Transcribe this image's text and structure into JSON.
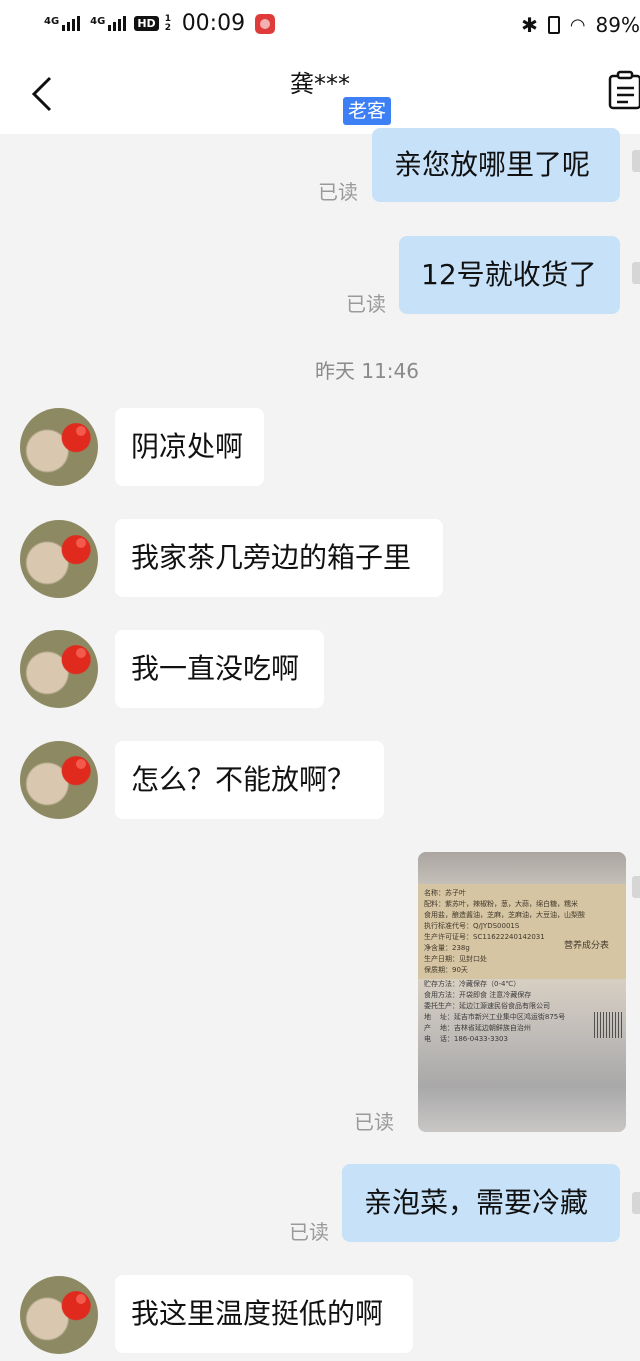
{
  "status_bar": {
    "sim1": "4G",
    "sim2": "4G",
    "hd": "HD",
    "hd_sub": "1 2",
    "time": "00:09",
    "battery": "89%"
  },
  "header": {
    "title": "龚***",
    "tag": "老客"
  },
  "messages": [
    {
      "side": "out",
      "text": "亲您放哪里了呢",
      "read": "已读"
    },
    {
      "side": "out",
      "text": "12号就收货了",
      "read": "已读"
    },
    {
      "timestamp": "昨天 11:46"
    },
    {
      "side": "in",
      "text": "阴凉处啊"
    },
    {
      "side": "in",
      "text": "我家茶几旁边的箱子里"
    },
    {
      "side": "in",
      "text": "我一直没吃啊"
    },
    {
      "side": "in",
      "text": "怎么？不能放啊？"
    },
    {
      "side": "out",
      "image": "product-label-photo",
      "read": "已读"
    },
    {
      "side": "out",
      "text": "亲泡菜，需要冷藏",
      "read": "已读"
    },
    {
      "side": "in",
      "text": "我这里温度挺低的啊"
    }
  ],
  "photo_text": {
    "top": "名称：苏子叶\n配料：紫苏叶，辣椒粉，葱，大蒜，绵白糖，糯米\n食用盐，酿造酱油，芝麻，芝麻油，大豆油，山梨酸\n执行标准代号：Q/JYDS0001S\n生产许可证号：SC11622240142031\n净含量：238g\n生产日期：见封口处\n保质期：90天",
    "bottom": "贮存方法：冷藏保存（0-4℃）\n食用方法：开袋即食 注意冷藏保存\n委托生产：延边江源速民俗食品有限公司\n地    址：延吉市新兴工业集中区鸿运街875号\n产    地：吉林省延边朝鲜族自治州\n电    话：186-0433-3303",
    "panel_title": "营养成分表"
  }
}
